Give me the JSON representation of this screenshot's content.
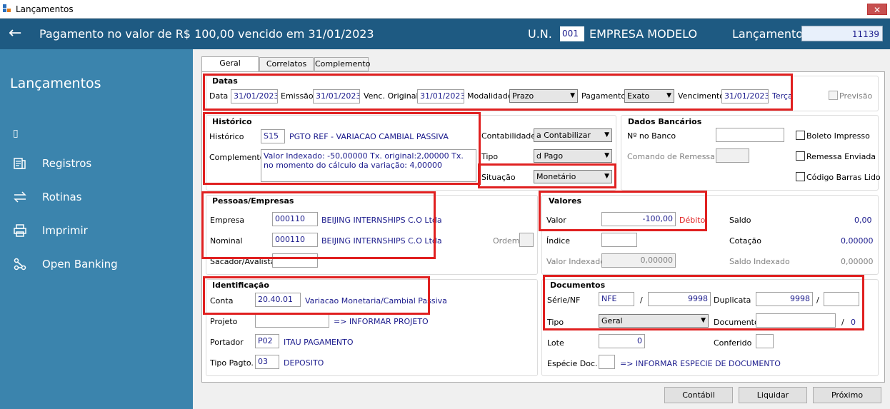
{
  "window": {
    "title": "Lançamentos",
    "close": "✕"
  },
  "header": {
    "back": "←",
    "title": "Pagamento no valor de R$ 100,00 vencido em 31/01/2023",
    "un_label": "U.N.",
    "un_code": "001",
    "company": "EMPRESA MODELO",
    "lanc_label": "Lançamento",
    "lanc_value": "11139"
  },
  "sidebar": {
    "title": "Lançamentos",
    "cursor": "▯",
    "items": [
      {
        "label": "Registros",
        "icon": "registers-icon"
      },
      {
        "label": "Rotinas",
        "icon": "transfer-arrows-icon"
      },
      {
        "label": "Imprimir",
        "icon": "printer-icon"
      },
      {
        "label": "Open Banking",
        "icon": "network-icon"
      }
    ]
  },
  "tabs": [
    {
      "label": "Geral"
    },
    {
      "label": "Correlatos"
    },
    {
      "label": "Complemento"
    }
  ],
  "datas": {
    "title": "Datas",
    "data_label": "Data",
    "data": "31/01/2023",
    "emissao_label": "Emissão",
    "emissao": "31/01/2023",
    "venc_label": "Venc. Original",
    "venc": "31/01/2023",
    "modalidade_label": "Modalidade",
    "modalidade": "Prazo",
    "pagamento_label": "Pagamento",
    "pagamento": "Exato",
    "vencimento_label": "Vencimento",
    "vencimento": "31/01/2023",
    "weekday": "Terça",
    "previsao": "Previsão"
  },
  "historico": {
    "title": "Histórico",
    "hist_label": "Histórico",
    "hist_code": "S15",
    "hist_text": "PGTO REF - VARIACAO CAMBIAL PASSIVA",
    "comp_label": "Complemento",
    "comp_text": "Valor Indexado: -50,00000 Tx. original:2,00000 Tx. no momento do cálculo da variação: 4,00000"
  },
  "contab": {
    "contab_label": "Contabilidade",
    "contab": "a Contabilizar",
    "tipo_label": "Tipo",
    "tipo": "d Pago",
    "situacao_label": "Situação",
    "situacao": "Monetário"
  },
  "bancarios": {
    "title": "Dados Bancários",
    "banco_label": "Nº no Banco",
    "remessa_label": "Comando de Remessa",
    "boleto": "Boleto Impresso",
    "remessa_env": "Remessa Enviada",
    "codigo": "Código Barras Lido"
  },
  "pessoas": {
    "title": "Pessoas/Empresas",
    "empresa_label": "Empresa",
    "empresa_code": "000110",
    "empresa_name": "BEIJING INTERNSHIPS C.O Ltda",
    "nominal_label": "Nominal",
    "nominal_code": "000110",
    "nominal_name": "BEIJING INTERNSHIPS C.O Ltda",
    "ordem_label": "Ordem",
    "sacador_label": "Sacador/Avalista"
  },
  "valores": {
    "title": "Valores",
    "valor_label": "Valor",
    "valor": "-100,00",
    "debito": "Débito",
    "saldo_label": "Saldo",
    "saldo": "0,00",
    "indice_label": "Índice",
    "cotacao_label": "Cotação",
    "cotacao": "0,00000",
    "vindex_label": "Valor Indexado",
    "vindex": "0,00000",
    "sindex_label": "Saldo Indexado",
    "sindex": "0,00000"
  },
  "ident": {
    "title": "Identificação",
    "conta_label": "Conta",
    "conta_code": "20.40.01",
    "conta_name": "Variacao Monetaria/Cambial Passiva",
    "projeto_label": "Projeto",
    "projeto_text": "=> INFORMAR PROJETO",
    "portador_label": "Portador",
    "portador_code": "P02",
    "portador_name": "ITAU PAGAMENTO",
    "tipopagto_label": "Tipo Pagto.",
    "tipopagto_code": "03",
    "tipopagto_name": "DEPOSITO"
  },
  "docs": {
    "title": "Documentos",
    "serie_label": "Série/NF",
    "serie": "NFE",
    "slash": "/",
    "nf": "9998",
    "dup_label": "Duplicata",
    "dup": "9998",
    "tipo_label": "Tipo",
    "tipo": "Geral",
    "doc_label": "Documento",
    "doc_num": "0",
    "lote_label": "Lote",
    "lote": "0",
    "conferido_label": "Conferido",
    "especie_label": "Espécie Doc.",
    "especie_text": "=> INFORMAR ESPECIE DE DOCUMENTO"
  },
  "buttons": {
    "contabil": "Contábil",
    "liquidar": "Liquidar",
    "proximo": "Próximo"
  },
  "colors": {
    "header": "#1e5a82",
    "sidebar": "#3b84ad",
    "highlight": "#e02020",
    "value_text": "#1a1a8c"
  }
}
